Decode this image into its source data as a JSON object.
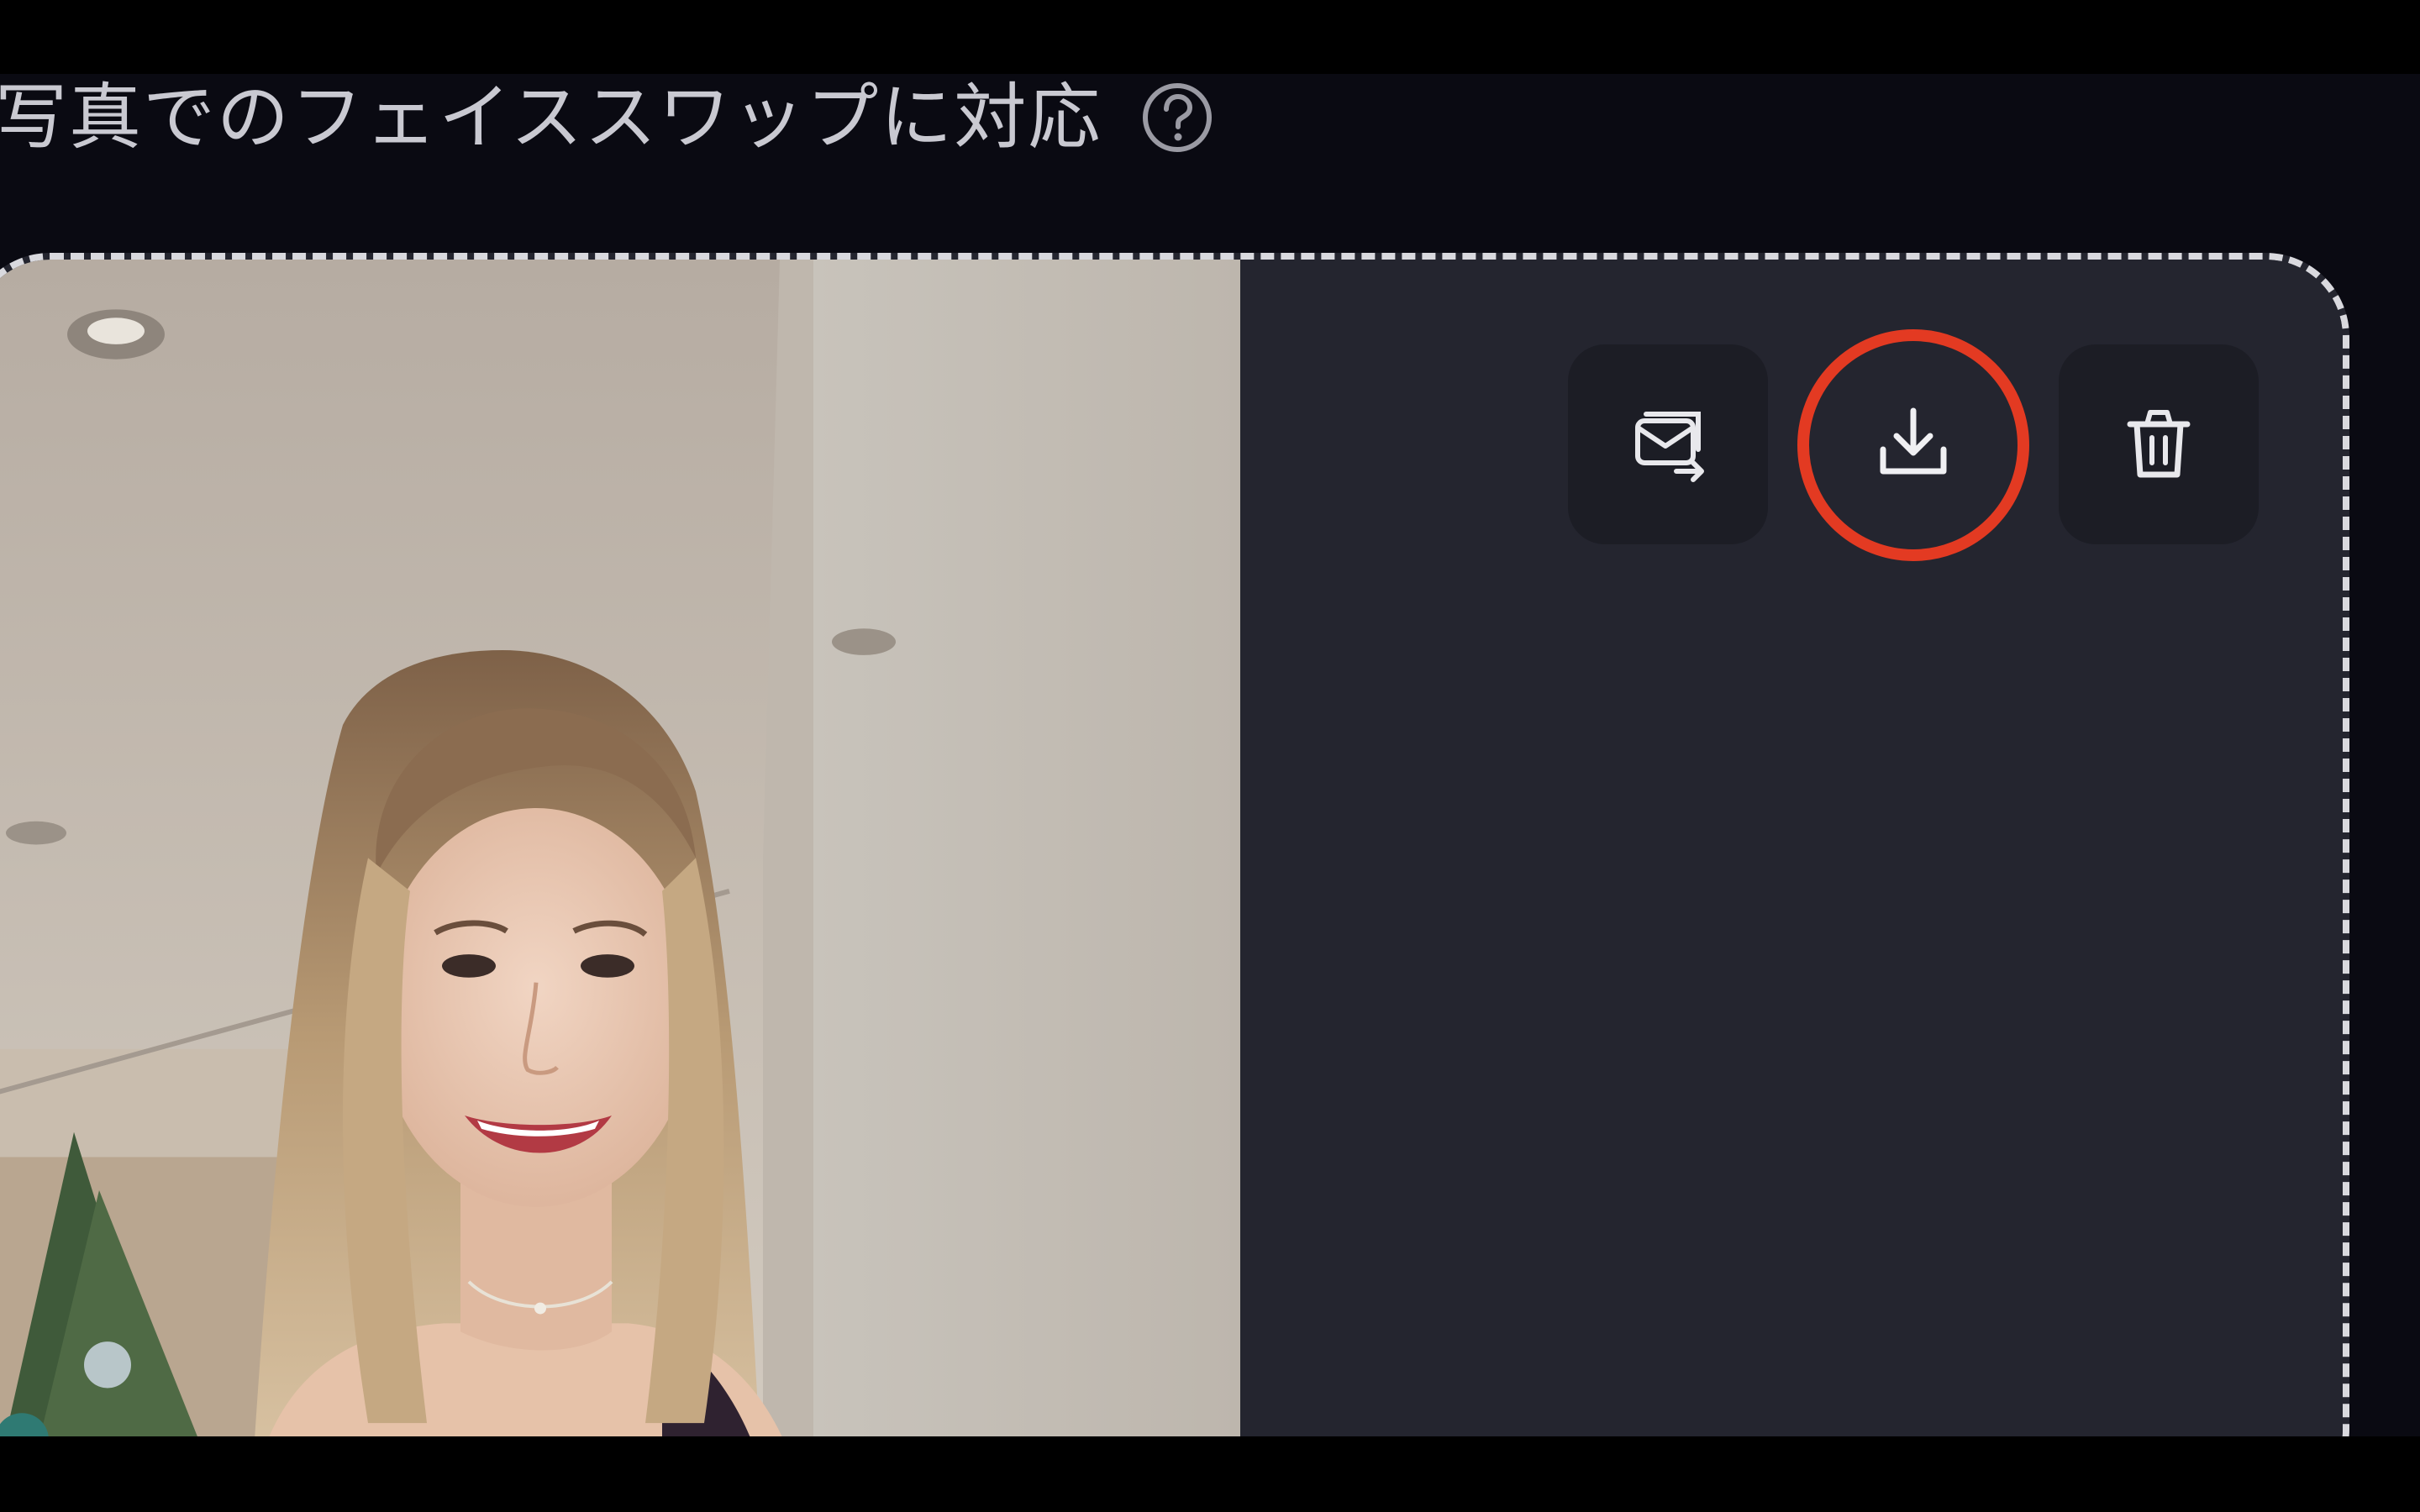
{
  "headline": {
    "text": "写真でのフェイススワップに対応"
  },
  "icons": {
    "help": "question-circle-icon",
    "share": "share-email-icon",
    "download": "download-icon",
    "delete": "trash-icon"
  },
  "colors": {
    "background": "#0a0a12",
    "panel": "#24252f",
    "button": "#1c1d25",
    "highlight": "#e33a22",
    "dashed_border": "#d9d9de"
  }
}
